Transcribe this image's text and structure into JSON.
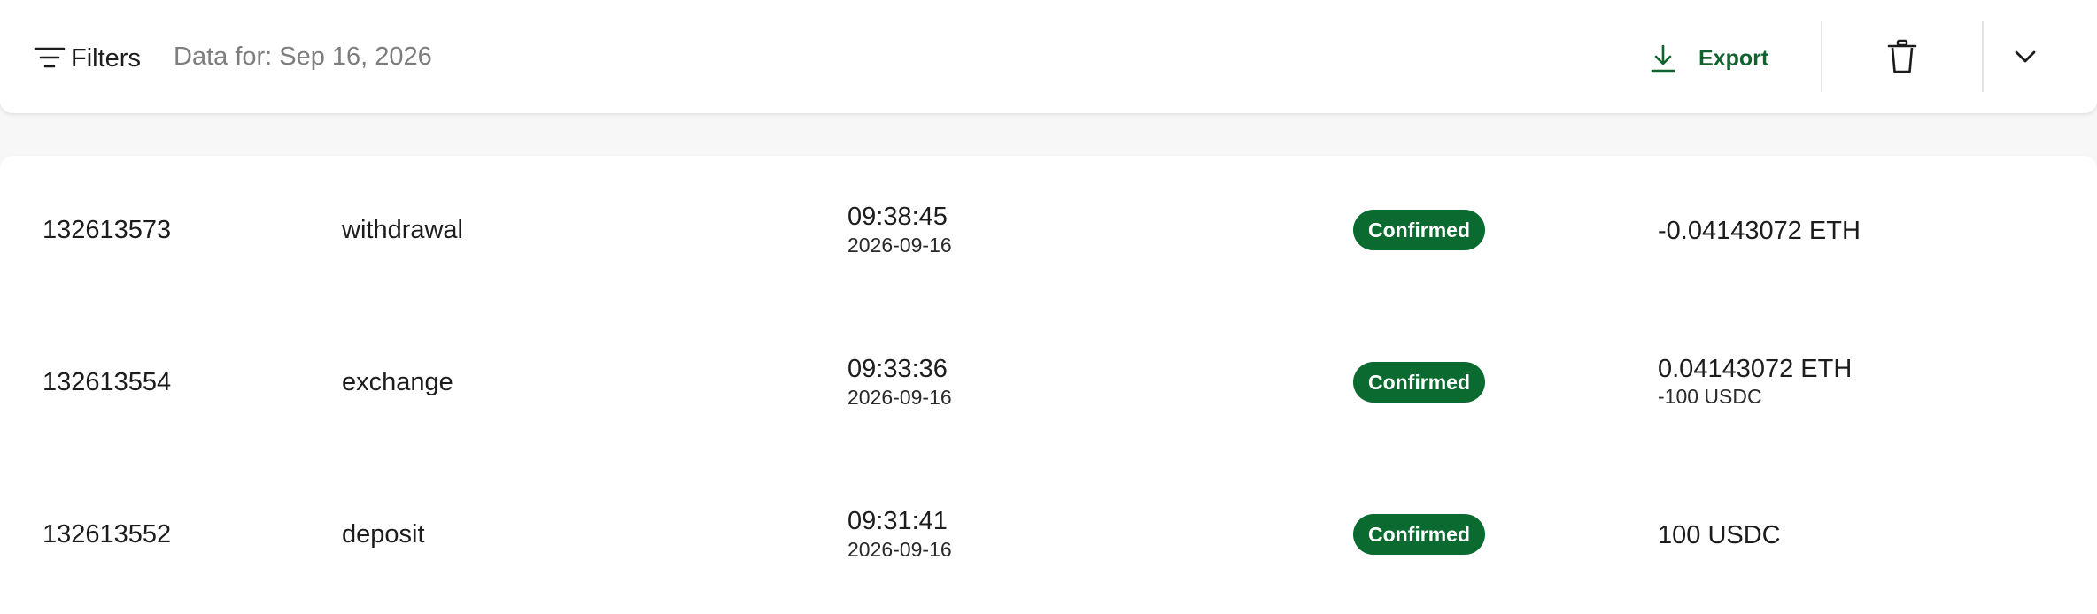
{
  "toolbar": {
    "filters_label": "Filters",
    "data_for": "Data for: Sep 16, 2026",
    "export_label": "Export",
    "icons": {
      "filters": "filter-lines-icon",
      "export": "download-icon",
      "delete": "trash-icon",
      "expand": "chevron-down-icon"
    }
  },
  "colors": {
    "accent": "#10622f",
    "badge_bg": "#0b6a2f",
    "muted_text": "#7d7d7d"
  },
  "transactions": [
    {
      "id": "132613573",
      "type": "withdrawal",
      "time": "09:38:45",
      "date": "2026-09-16",
      "status": "Confirmed",
      "amount": "-0.04143072 ETH",
      "amount_secondary": ""
    },
    {
      "id": "132613554",
      "type": "exchange",
      "time": "09:33:36",
      "date": "2026-09-16",
      "status": "Confirmed",
      "amount": "0.04143072 ETH",
      "amount_secondary": "-100 USDC"
    },
    {
      "id": "132613552",
      "type": "deposit",
      "time": "09:31:41",
      "date": "2026-09-16",
      "status": "Confirmed",
      "amount": "100 USDC",
      "amount_secondary": ""
    }
  ]
}
